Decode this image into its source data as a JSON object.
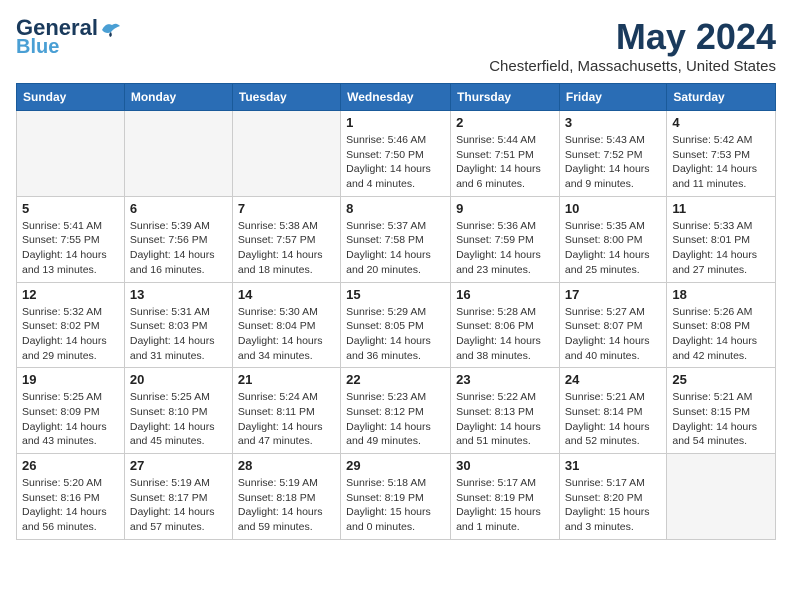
{
  "logo": {
    "line1": "General",
    "line2": "Blue"
  },
  "title": "May 2024",
  "location": "Chesterfield, Massachusetts, United States",
  "days_of_week": [
    "Sunday",
    "Monday",
    "Tuesday",
    "Wednesday",
    "Thursday",
    "Friday",
    "Saturday"
  ],
  "weeks": [
    [
      {
        "day": "",
        "info": ""
      },
      {
        "day": "",
        "info": ""
      },
      {
        "day": "",
        "info": ""
      },
      {
        "day": "1",
        "info": "Sunrise: 5:46 AM\nSunset: 7:50 PM\nDaylight: 14 hours\nand 4 minutes."
      },
      {
        "day": "2",
        "info": "Sunrise: 5:44 AM\nSunset: 7:51 PM\nDaylight: 14 hours\nand 6 minutes."
      },
      {
        "day": "3",
        "info": "Sunrise: 5:43 AM\nSunset: 7:52 PM\nDaylight: 14 hours\nand 9 minutes."
      },
      {
        "day": "4",
        "info": "Sunrise: 5:42 AM\nSunset: 7:53 PM\nDaylight: 14 hours\nand 11 minutes."
      }
    ],
    [
      {
        "day": "5",
        "info": "Sunrise: 5:41 AM\nSunset: 7:55 PM\nDaylight: 14 hours\nand 13 minutes."
      },
      {
        "day": "6",
        "info": "Sunrise: 5:39 AM\nSunset: 7:56 PM\nDaylight: 14 hours\nand 16 minutes."
      },
      {
        "day": "7",
        "info": "Sunrise: 5:38 AM\nSunset: 7:57 PM\nDaylight: 14 hours\nand 18 minutes."
      },
      {
        "day": "8",
        "info": "Sunrise: 5:37 AM\nSunset: 7:58 PM\nDaylight: 14 hours\nand 20 minutes."
      },
      {
        "day": "9",
        "info": "Sunrise: 5:36 AM\nSunset: 7:59 PM\nDaylight: 14 hours\nand 23 minutes."
      },
      {
        "day": "10",
        "info": "Sunrise: 5:35 AM\nSunset: 8:00 PM\nDaylight: 14 hours\nand 25 minutes."
      },
      {
        "day": "11",
        "info": "Sunrise: 5:33 AM\nSunset: 8:01 PM\nDaylight: 14 hours\nand 27 minutes."
      }
    ],
    [
      {
        "day": "12",
        "info": "Sunrise: 5:32 AM\nSunset: 8:02 PM\nDaylight: 14 hours\nand 29 minutes."
      },
      {
        "day": "13",
        "info": "Sunrise: 5:31 AM\nSunset: 8:03 PM\nDaylight: 14 hours\nand 31 minutes."
      },
      {
        "day": "14",
        "info": "Sunrise: 5:30 AM\nSunset: 8:04 PM\nDaylight: 14 hours\nand 34 minutes."
      },
      {
        "day": "15",
        "info": "Sunrise: 5:29 AM\nSunset: 8:05 PM\nDaylight: 14 hours\nand 36 minutes."
      },
      {
        "day": "16",
        "info": "Sunrise: 5:28 AM\nSunset: 8:06 PM\nDaylight: 14 hours\nand 38 minutes."
      },
      {
        "day": "17",
        "info": "Sunrise: 5:27 AM\nSunset: 8:07 PM\nDaylight: 14 hours\nand 40 minutes."
      },
      {
        "day": "18",
        "info": "Sunrise: 5:26 AM\nSunset: 8:08 PM\nDaylight: 14 hours\nand 42 minutes."
      }
    ],
    [
      {
        "day": "19",
        "info": "Sunrise: 5:25 AM\nSunset: 8:09 PM\nDaylight: 14 hours\nand 43 minutes."
      },
      {
        "day": "20",
        "info": "Sunrise: 5:25 AM\nSunset: 8:10 PM\nDaylight: 14 hours\nand 45 minutes."
      },
      {
        "day": "21",
        "info": "Sunrise: 5:24 AM\nSunset: 8:11 PM\nDaylight: 14 hours\nand 47 minutes."
      },
      {
        "day": "22",
        "info": "Sunrise: 5:23 AM\nSunset: 8:12 PM\nDaylight: 14 hours\nand 49 minutes."
      },
      {
        "day": "23",
        "info": "Sunrise: 5:22 AM\nSunset: 8:13 PM\nDaylight: 14 hours\nand 51 minutes."
      },
      {
        "day": "24",
        "info": "Sunrise: 5:21 AM\nSunset: 8:14 PM\nDaylight: 14 hours\nand 52 minutes."
      },
      {
        "day": "25",
        "info": "Sunrise: 5:21 AM\nSunset: 8:15 PM\nDaylight: 14 hours\nand 54 minutes."
      }
    ],
    [
      {
        "day": "26",
        "info": "Sunrise: 5:20 AM\nSunset: 8:16 PM\nDaylight: 14 hours\nand 56 minutes."
      },
      {
        "day": "27",
        "info": "Sunrise: 5:19 AM\nSunset: 8:17 PM\nDaylight: 14 hours\nand 57 minutes."
      },
      {
        "day": "28",
        "info": "Sunrise: 5:19 AM\nSunset: 8:18 PM\nDaylight: 14 hours\nand 59 minutes."
      },
      {
        "day": "29",
        "info": "Sunrise: 5:18 AM\nSunset: 8:19 PM\nDaylight: 15 hours\nand 0 minutes."
      },
      {
        "day": "30",
        "info": "Sunrise: 5:17 AM\nSunset: 8:19 PM\nDaylight: 15 hours\nand 1 minute."
      },
      {
        "day": "31",
        "info": "Sunrise: 5:17 AM\nSunset: 8:20 PM\nDaylight: 15 hours\nand 3 minutes."
      },
      {
        "day": "",
        "info": ""
      }
    ]
  ]
}
